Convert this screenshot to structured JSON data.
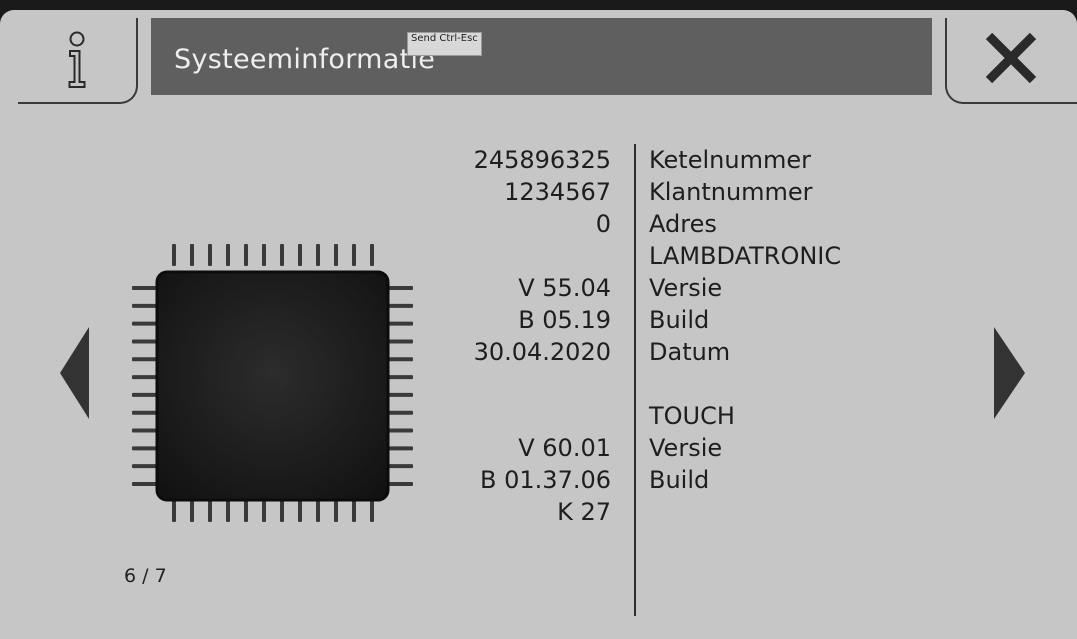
{
  "header": {
    "title": "Systeeminformatie",
    "tooltip": "Send Ctrl-Esc"
  },
  "icons": {
    "info": "info-icon",
    "close": "close-icon",
    "prev": "arrow-left-icon",
    "next": "arrow-right-icon",
    "chip": "chip-icon"
  },
  "pager": {
    "text": "6 / 7"
  },
  "info_rows": [
    {
      "value": "245896325",
      "label": "Ketelnummer"
    },
    {
      "value": "1234567",
      "label": "Klantnummer"
    },
    {
      "value": "0",
      "label": "Adres"
    },
    {
      "value": "",
      "label": "LAMBDATRONIC"
    },
    {
      "value": "V 55.04",
      "label": "Versie"
    },
    {
      "value": "B 05.19",
      "label": "Build"
    },
    {
      "value": "30.04.2020",
      "label": "Datum"
    },
    {
      "value": "",
      "label": ""
    },
    {
      "value": "",
      "label": "TOUCH"
    },
    {
      "value": "V 60.01",
      "label": "Versie"
    },
    {
      "value": "B 01.37.06",
      "label": "Build"
    },
    {
      "value": "K 27",
      "label": ""
    }
  ],
  "colors": {
    "background": "#c6c6c6",
    "title_bar": "#5f5f5f",
    "title_text": "#eeeeee",
    "text": "#1e1e1e"
  }
}
